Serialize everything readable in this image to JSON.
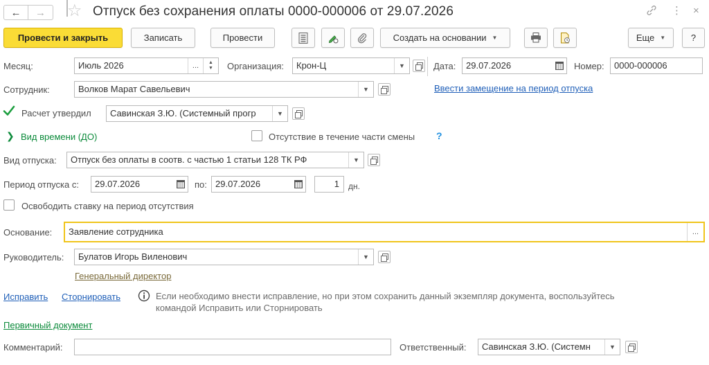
{
  "window": {
    "title": "Отпуск без сохранения оплаты 0000-000006 от 29.07.2026",
    "nav_back": "←",
    "nav_forward": "→",
    "favorite_icon": "star-icon",
    "link_icon": "🔗",
    "more_icon": "⋮",
    "close_icon": "×"
  },
  "toolbar": {
    "post_close": "Провести и закрыть",
    "save": "Записать",
    "post": "Провести",
    "create_based": "Создать на основании",
    "more": "Еще",
    "help": "?"
  },
  "form": {
    "month_label": "Месяц:",
    "month_value": "Июль 2026",
    "org_label": "Организация:",
    "org_value": "Крон-Ц",
    "date_label": "Дата:",
    "date_value": "29.07.2026",
    "number_label": "Номер:",
    "number_value": "0000-000006",
    "employee_label": "Сотрудник:",
    "employee_value": "Волков Марат Савельевич",
    "substitute_link": "Ввести замещение на период отпуска",
    "approved_label": "Расчет утвердил",
    "approved_checked": true,
    "approved_value": "Савинская З.Ю. (Системный прогр",
    "time_kind": "Вид времени (ДО)",
    "partial_shift_label": "Отсутствие в течение части смены",
    "partial_shift_help": "?",
    "leave_kind_label": "Вид отпуска:",
    "leave_kind_value": "Отпуск без оплаты в соотв. с частью 1 статьи 128 ТК РФ",
    "period_from_label": "Период отпуска с:",
    "period_from_value": "29.07.2026",
    "period_to_label": "по:",
    "period_to_value": "29.07.2026",
    "days_value": "1",
    "days_unit": "дн.",
    "free_rate_label": "Освободить ставку на период отсутствия",
    "basis_label": "Основание:",
    "basis_value": "Заявление сотрудника",
    "basis_more": "...",
    "head_label": "Руководитель:",
    "head_value": "Булатов Игорь Виленович",
    "head_position": "Генеральный директор",
    "fix_link": "Исправить",
    "reverse_link": "Сторнировать",
    "info_text_line1": "Если необходимо внести исправление, но при этом сохранить данный экземпляр документа, воспользуйтесь",
    "info_text_line2": "командой Исправить или Сторнировать",
    "primary_doc_link": "Первичный документ",
    "comment_label": "Комментарий:",
    "comment_value": "",
    "responsible_label": "Ответственный:",
    "responsible_value": "Савинская З.Ю. (Системн"
  },
  "colors": {
    "primary_button": "#fadc36",
    "link": "#1f5fb8",
    "green_link": "#0b8a3a",
    "focus_border": "#f0c419"
  }
}
